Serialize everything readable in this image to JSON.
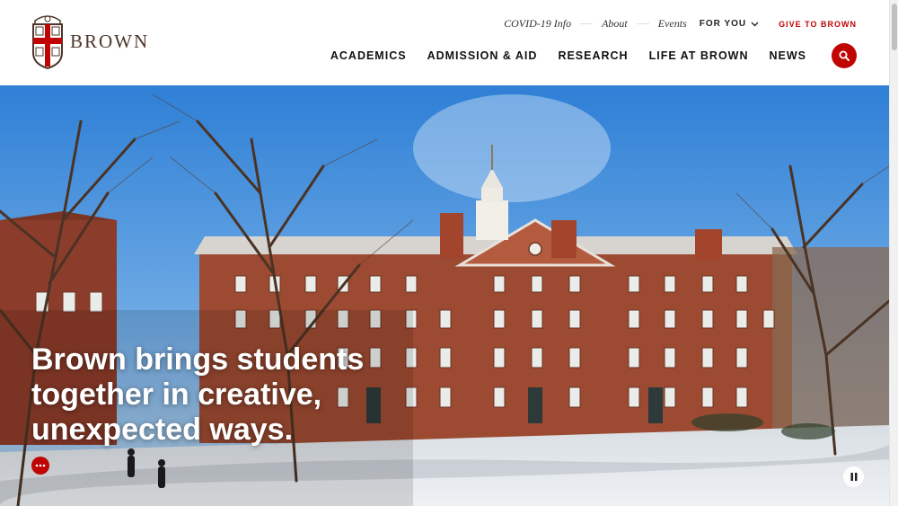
{
  "brand": {
    "wordmark": "BROWN",
    "color": "#4e3629",
    "accent": "#c00404"
  },
  "utility_nav": {
    "links": [
      "COVID-19 Info",
      "About",
      "Events"
    ],
    "for_you": "FOR YOU",
    "give": "GIVE TO BROWN"
  },
  "main_nav": [
    "ACADEMICS",
    "ADMISSION & AID",
    "RESEARCH",
    "LIFE AT BROWN",
    "NEWS"
  ],
  "icons": {
    "search": "search-icon",
    "dropdown": "chevron-down-icon",
    "more": "more-dots-icon",
    "pause": "pause-icon",
    "logo": "brown-shield-logo"
  },
  "hero": {
    "headline": "Brown brings students together in creative, unexpected ways."
  }
}
